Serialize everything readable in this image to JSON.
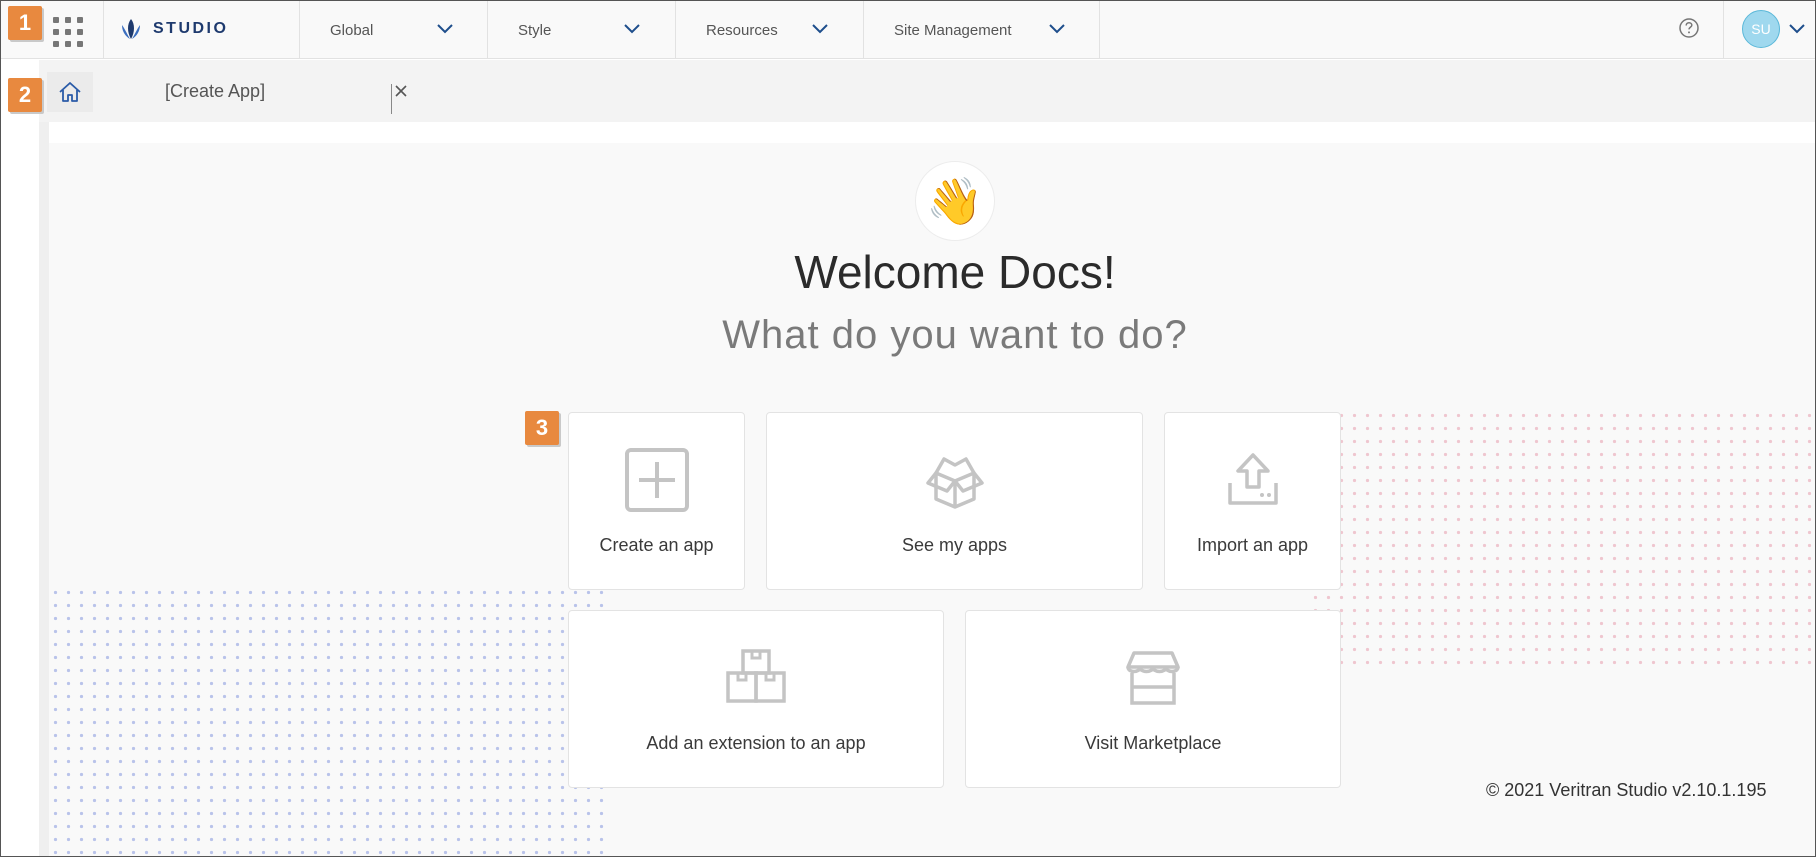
{
  "nav": {
    "brand": "STUDIO",
    "menus": [
      {
        "label": "Global"
      },
      {
        "label": "Style"
      },
      {
        "label": "Resources"
      },
      {
        "label": "Site Management"
      }
    ],
    "avatar_initials": "SU",
    "icons": {
      "apps": "grid-icon",
      "help": "help-circle-icon",
      "logo": "lotus-logo-icon"
    }
  },
  "badges": [
    "1",
    "2",
    "3"
  ],
  "tabs": {
    "active_label": "[Create App]"
  },
  "welcome": {
    "emoji": "👋",
    "title": "Welcome Docs!",
    "subtitle": "What do you want to do?"
  },
  "cards": [
    {
      "label": "Create an app",
      "icon": "plus-square-icon"
    },
    {
      "label": "See my apps",
      "icon": "open-box-icon"
    },
    {
      "label": "Import an app",
      "icon": "upload-icon"
    },
    {
      "label": "Add an extension to an app",
      "icon": "stacked-boxes-icon"
    },
    {
      "label": "Visit Marketplace",
      "icon": "storefront-icon"
    }
  ],
  "footer": "© 2021 Veritran Studio v2.10.1.195",
  "colors": {
    "accent_badge": "#e8893f",
    "brand_blue": "#1e3a6e",
    "avatar": "#9fd8ee"
  }
}
